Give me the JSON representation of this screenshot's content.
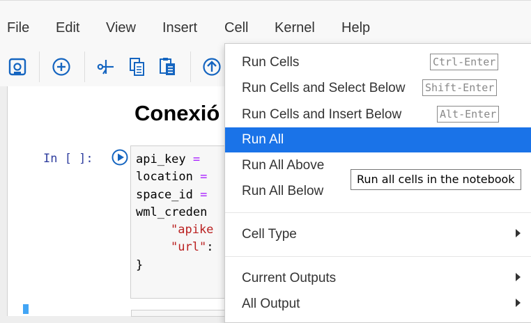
{
  "menubar": {
    "items": [
      "File",
      "Edit",
      "View",
      "Insert",
      "Cell",
      "Kernel",
      "Help"
    ]
  },
  "toolbar": {
    "icons": [
      "save-icon",
      "add-cell-icon",
      "cut-icon",
      "copy-icon",
      "paste-icon",
      "move-up-icon"
    ]
  },
  "notebook": {
    "heading": "Conexió",
    "prompt": "In [ ]:",
    "code": {
      "line1_var": "api_key",
      "line1_op": " =",
      "line2_var": "location",
      "line2_op": " =",
      "line3_var": "space_id",
      "line3_op": " =",
      "line4": "wml_creden",
      "line5_str": "\"apike",
      "line6_str": "\"url\"",
      "line6_colon": ":",
      "line7": "}"
    }
  },
  "cell_menu": {
    "items": [
      {
        "label": "Run Cells",
        "shortcut": "Ctrl-Enter"
      },
      {
        "label": "Run Cells and Select Below",
        "shortcut": "Shift-Enter"
      },
      {
        "label": "Run Cells and Insert Below",
        "shortcut": "Alt-Enter"
      },
      {
        "label": "Run All"
      },
      {
        "label": "Run All Above"
      },
      {
        "label": "Run All Below"
      },
      {
        "label": "Cell Type"
      },
      {
        "label": "Current Outputs"
      },
      {
        "label": "All Output"
      }
    ],
    "active_index": 3,
    "active_color": "#1a73e8"
  },
  "tooltip": {
    "text": "Run all cells in the notebook"
  }
}
